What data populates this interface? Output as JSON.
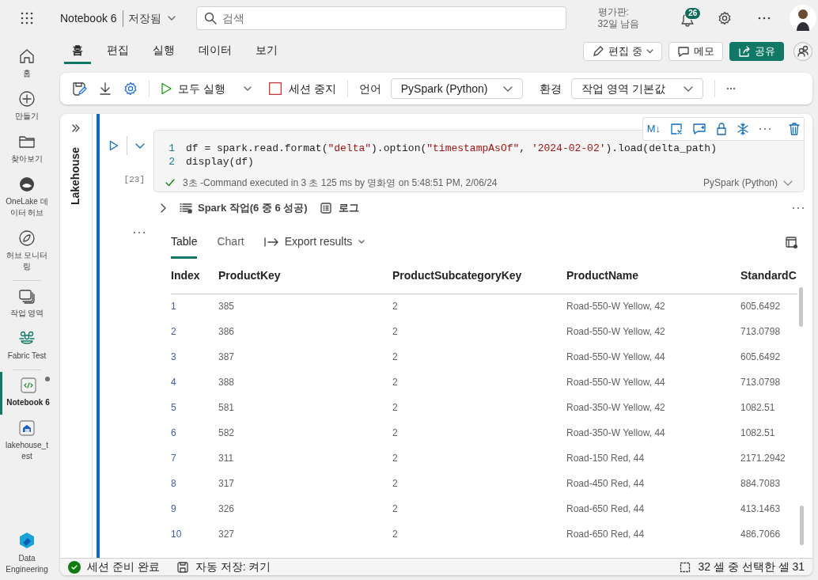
{
  "top_bar": {
    "app_title": "Notebook 6",
    "save_state": "저장됨",
    "search_placeholder": "검색",
    "trial_line_1": "평가판:",
    "trial_line_2": "32일 남음",
    "notification_count": "26"
  },
  "nav_rail": {
    "sections": [
      {
        "items": [
          {
            "label": "홈",
            "selected": false,
            "dot": false
          },
          {
            "label": "만들기",
            "selected": false,
            "dot": false
          },
          {
            "label": "찾아보기",
            "selected": false,
            "dot": false
          },
          {
            "label": "OneLake 데이터 허브",
            "selected": false,
            "dot": false
          },
          {
            "label": "허브 모니터링",
            "selected": false,
            "dot": false
          }
        ]
      },
      {
        "items": [
          {
            "label": "작업 영역",
            "selected": false,
            "dot": false
          },
          {
            "label": "Fabric Test",
            "selected": false,
            "dot": false
          }
        ]
      },
      {
        "items": [
          {
            "label": "Notebook 6",
            "selected": true,
            "dot": true
          },
          {
            "label": "lakehouse_test",
            "selected": false,
            "dot": false
          }
        ]
      }
    ],
    "footer": "Data Engineering"
  },
  "ribbon": {
    "tabs": [
      {
        "label": "홈",
        "selected": true
      },
      {
        "label": "편집",
        "selected": false
      },
      {
        "label": "실행",
        "selected": false
      },
      {
        "label": "데이터",
        "selected": false
      },
      {
        "label": "보기",
        "selected": false
      }
    ],
    "edit_mode": "편집 중",
    "comments": "메모",
    "share": "공유"
  },
  "toolbar": {
    "run_all": "모두 실행",
    "stop_session": "세션 중지",
    "language_label": "언어",
    "language": "PySpark (Python)",
    "environment_label": "환경",
    "environment": "작업 영역 기본값"
  },
  "side_panel": {
    "title": "Lakehouse"
  },
  "cell": {
    "toolbar_markdown": "M↓",
    "execution_count": "[23]",
    "lines": [
      {
        "number": "1",
        "tokens": [
          {
            "text": "df = spark.read.format(",
            "kind": "plain"
          },
          {
            "text": "\"delta\"",
            "kind": "string"
          },
          {
            "text": ").option(",
            "kind": "plain"
          },
          {
            "text": "\"timestampAsOf\"",
            "kind": "string"
          },
          {
            "text": ", ",
            "kind": "plain"
          },
          {
            "text": "'2024-02-02'",
            "kind": "string"
          },
          {
            "text": ").load(delta_path)",
            "kind": "plain"
          }
        ]
      },
      {
        "number": "2",
        "tokens": [
          {
            "text": "display(df)",
            "kind": "plain"
          }
        ]
      }
    ],
    "status": "3초 -Command executed in 3 초 125 ms by 명화영 on 5:48:51 PM, 2/06/24",
    "language": "PySpark (Python)"
  },
  "output": {
    "spark_jobs": "Spark 작업(6 중 6 성공)",
    "logs": "로그",
    "expanded": false,
    "tabs": [
      {
        "label": "Table",
        "selected": true
      },
      {
        "label": "Chart",
        "selected": false
      }
    ],
    "export": "Export results",
    "table": {
      "columns": [
        "Index",
        "ProductKey",
        "ProductSubcategoryKey",
        "ProductName",
        "StandardC"
      ],
      "rows": [
        [
          "1",
          "385",
          "2",
          "Road-550-W Yellow, 42",
          "605.6492"
        ],
        [
          "2",
          "386",
          "2",
          "Road-550-W Yellow, 42",
          "713.0798"
        ],
        [
          "3",
          "387",
          "2",
          "Road-550-W Yellow, 44",
          "605.6492"
        ],
        [
          "4",
          "388",
          "2",
          "Road-550-W Yellow, 44",
          "713.0798"
        ],
        [
          "5",
          "581",
          "2",
          "Road-350-W Yellow, 42",
          "1082.51"
        ],
        [
          "6",
          "582",
          "2",
          "Road-350-W Yellow, 44",
          "1082.51"
        ],
        [
          "7",
          "311",
          "2",
          "Road-150 Red, 44",
          "2171.2942"
        ],
        [
          "8",
          "317",
          "2",
          "Road-450 Red, 44",
          "884.7083"
        ],
        [
          "9",
          "326",
          "2",
          "Road-650 Red, 44",
          "413.1463"
        ],
        [
          "10",
          "327",
          "2",
          "Road-650 Red, 44",
          "486.7066"
        ]
      ]
    }
  },
  "status_bar": {
    "session": "세션 준비 완료",
    "autosave": "자동 저장: 켜기",
    "selection": "32 셀 중 선택한 셀 31"
  }
}
